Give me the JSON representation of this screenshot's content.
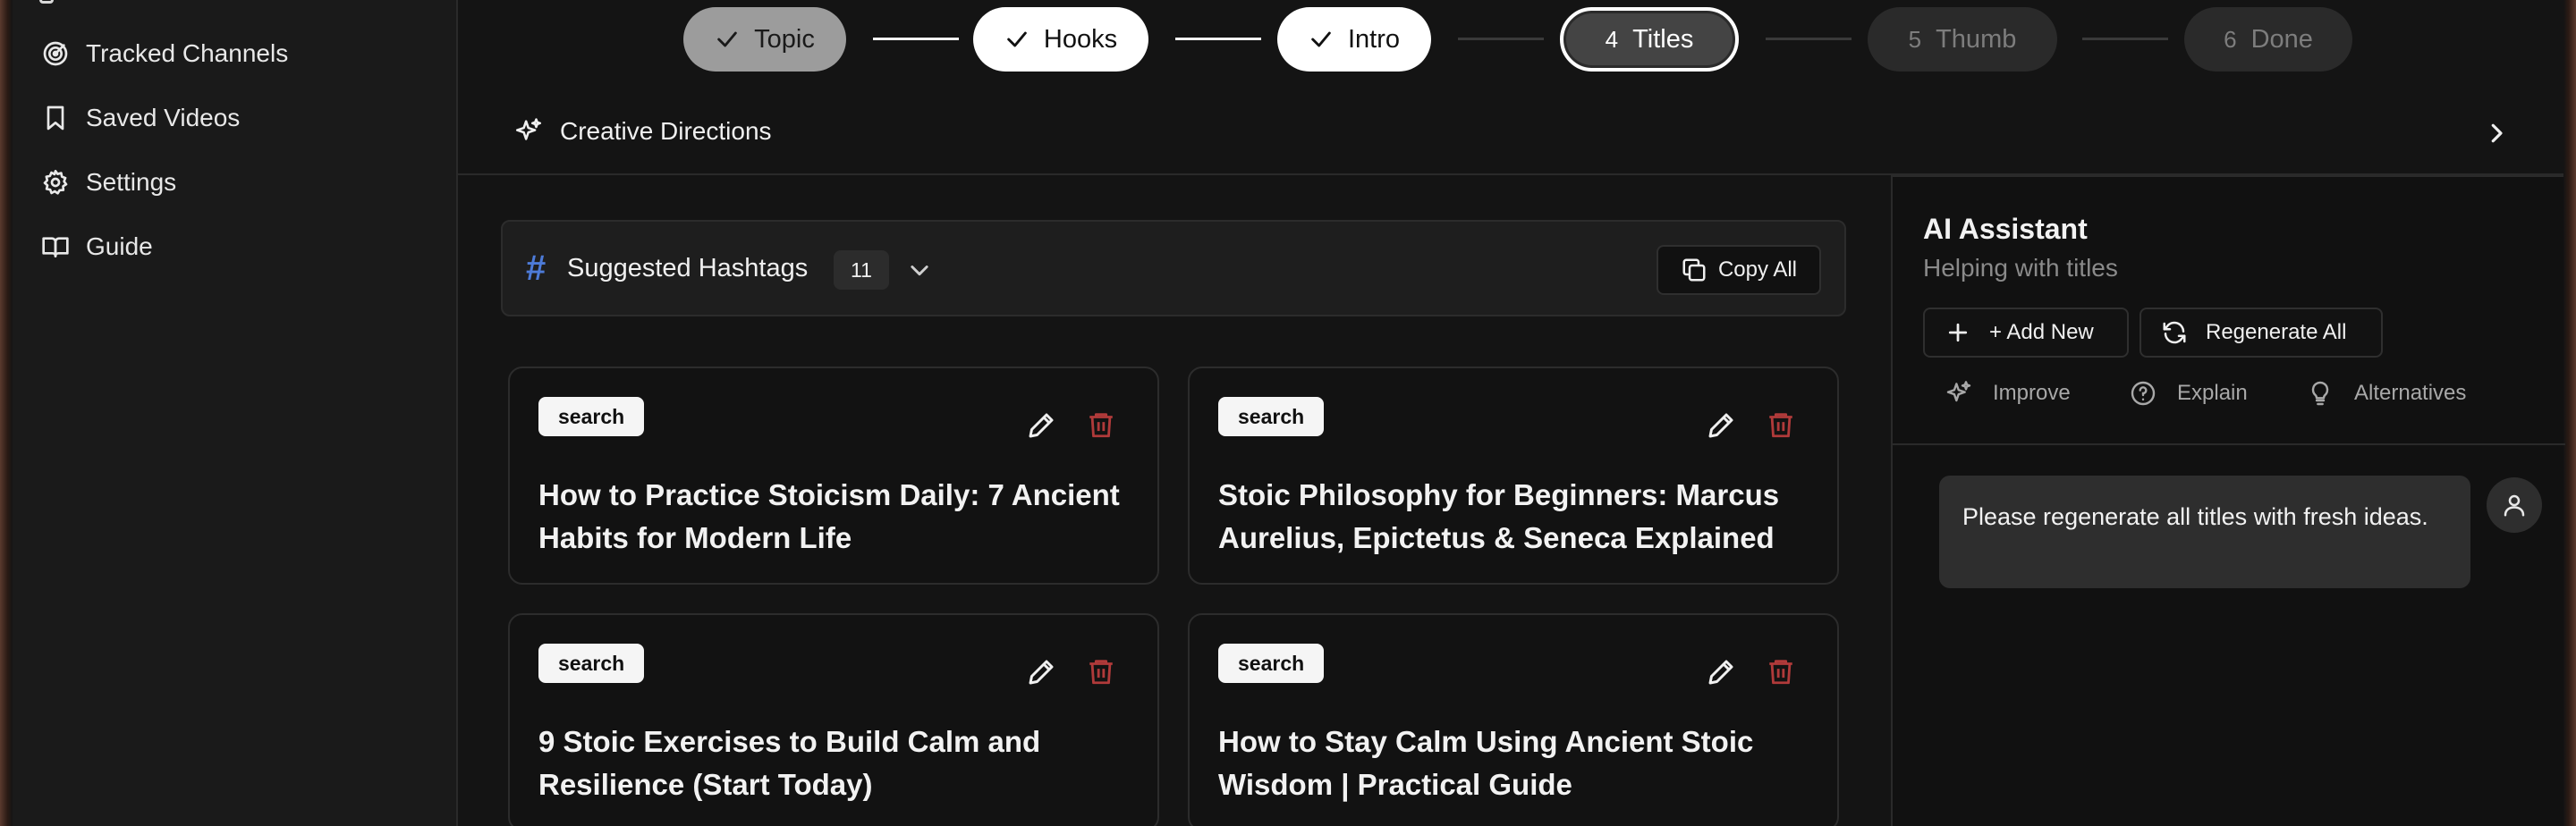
{
  "sidebar": {
    "items": [
      {
        "label": "Tracked Channels",
        "icon": "radar-icon"
      },
      {
        "label": "Saved Videos",
        "icon": "bookmark-icon"
      },
      {
        "label": "Settings",
        "icon": "gear-icon"
      },
      {
        "label": "Guide",
        "icon": "book-icon"
      }
    ]
  },
  "stepper": {
    "steps": [
      {
        "label": "Topic",
        "state": "completed"
      },
      {
        "label": "Hooks",
        "state": "completed"
      },
      {
        "label": "Intro",
        "state": "completed"
      },
      {
        "number": "4",
        "label": "Titles",
        "state": "active"
      },
      {
        "number": "5",
        "label": "Thumb",
        "state": "pending"
      },
      {
        "number": "6",
        "label": "Done",
        "state": "pending"
      }
    ]
  },
  "creative_directions": {
    "label": "Creative Directions"
  },
  "hashtags": {
    "title": "Suggested Hashtags",
    "count": "11",
    "copy_all_label": "Copy All",
    "accent_color": "#4d7bd8"
  },
  "titles": [
    {
      "tag": "search",
      "title": "How to Practice Stoicism Daily: 7 Ancient Habits for Modern Life"
    },
    {
      "tag": "search",
      "title": "Stoic Philosophy for Beginners: Marcus Aurelius, Epictetus & Seneca Explained"
    },
    {
      "tag": "search",
      "title": "9 Stoic Exercises to Build Calm and Resilience (Start Today)"
    },
    {
      "tag": "search",
      "title": "How to Stay Calm Using Ancient Stoic Wisdom | Practical Guide"
    }
  ],
  "ai_assistant": {
    "title": "AI Assistant",
    "subtitle": "Helping with titles",
    "add_new_label": "+ Add New",
    "regenerate_all_label": "Regenerate All",
    "actions": [
      "Improve",
      "Explain",
      "Alternatives"
    ],
    "messages": [
      {
        "role": "user",
        "text": "Please regenerate all titles with fresh ideas."
      }
    ]
  },
  "colors": {
    "delete_icon": "#b03a3a",
    "background": "#141414",
    "sidebar": "#1a1a1a"
  }
}
